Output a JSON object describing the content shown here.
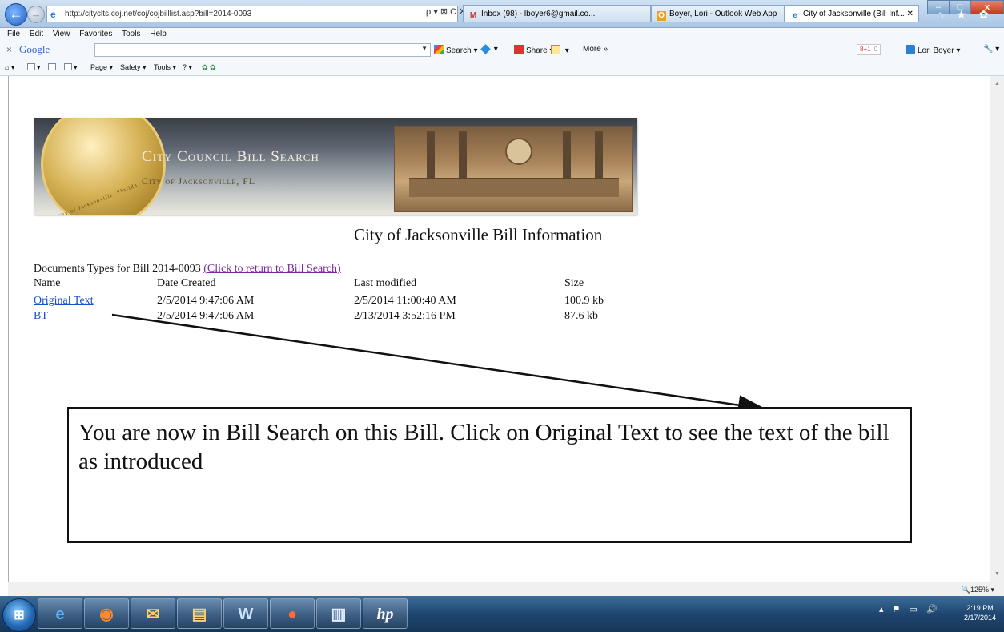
{
  "browser": {
    "address_url": "http://cityclts.coj.net/coj/cojbilllist.asp?bill=2014-0093",
    "address_controls": "ρ ▾ ⊠ C ✕",
    "tabs": [
      {
        "label": "Inbox (98) - lboyer6@gmail.co...",
        "icon": "gmail-icon"
      },
      {
        "label": "Boyer, Lori - Outlook Web App",
        "icon": "outlook-icon"
      },
      {
        "label": "City of Jacksonville (Bill Inf...",
        "icon": "ie-icon",
        "close": "✕"
      }
    ],
    "menu": [
      "File",
      "Edit",
      "View",
      "Favorites",
      "Tools",
      "Help"
    ],
    "window_controls": {
      "minimize": "–",
      "maximize": "□",
      "close": "x"
    },
    "home_tools": "⌂ ★ ✿"
  },
  "google_toolbar": {
    "close": "×",
    "logo": "Google",
    "search_label": "Search",
    "share_label": "Share",
    "more_label": "More »",
    "plusone_label": "8+1",
    "plusone_count": "0",
    "user_label": "Lori Boyer ▾",
    "settings": "🔧 ▾"
  },
  "command_bar": {
    "page_label": "Page ▾",
    "safety_label": "Safety ▾",
    "tools_label": "Tools ▾",
    "help_label": "? ▾"
  },
  "banner": {
    "title": "City Council Bill Search",
    "subtitle": "City of Jacksonville, FL",
    "seal_text": "City of Jacksonville, Florida"
  },
  "page": {
    "heading": "City of Jacksonville Bill Information",
    "doc_types_prefix": "Documents Types for Bill 2014-0093 ",
    "return_link": "(Click to return to Bill Search)",
    "columns": [
      "Name",
      "Date Created",
      "Last modified",
      "Size"
    ],
    "rows": [
      {
        "name": "Original Text",
        "created": "2/5/2014 9:47:06 AM",
        "modified": "2/5/2014 11:00:40 AM",
        "size": "100.9 kb"
      },
      {
        "name": "BT",
        "created": "2/5/2014 9:47:06 AM",
        "modified": "2/13/2014 3:52:16 PM",
        "size": "87.6 kb"
      }
    ]
  },
  "annotation": {
    "text": "You are now in Bill Search on this Bill. Click on Original Text to see the text of the bill as introduced"
  },
  "status_bar": {
    "zoom": "125%"
  },
  "taskbar": {
    "apps": [
      "ie-icon",
      "firefox-icon",
      "outlook-icon",
      "folder-icon",
      "word-icon",
      "chrome-icon",
      "notes-icon",
      "hp-icon"
    ],
    "clock_time": "2:19 PM",
    "clock_date": "2/17/2014"
  },
  "colors": {
    "link": "#1a4fcf",
    "visited_link": "#7a2a9a",
    "titlebar": "#a9c6e6",
    "taskbar": "#1f4670"
  }
}
